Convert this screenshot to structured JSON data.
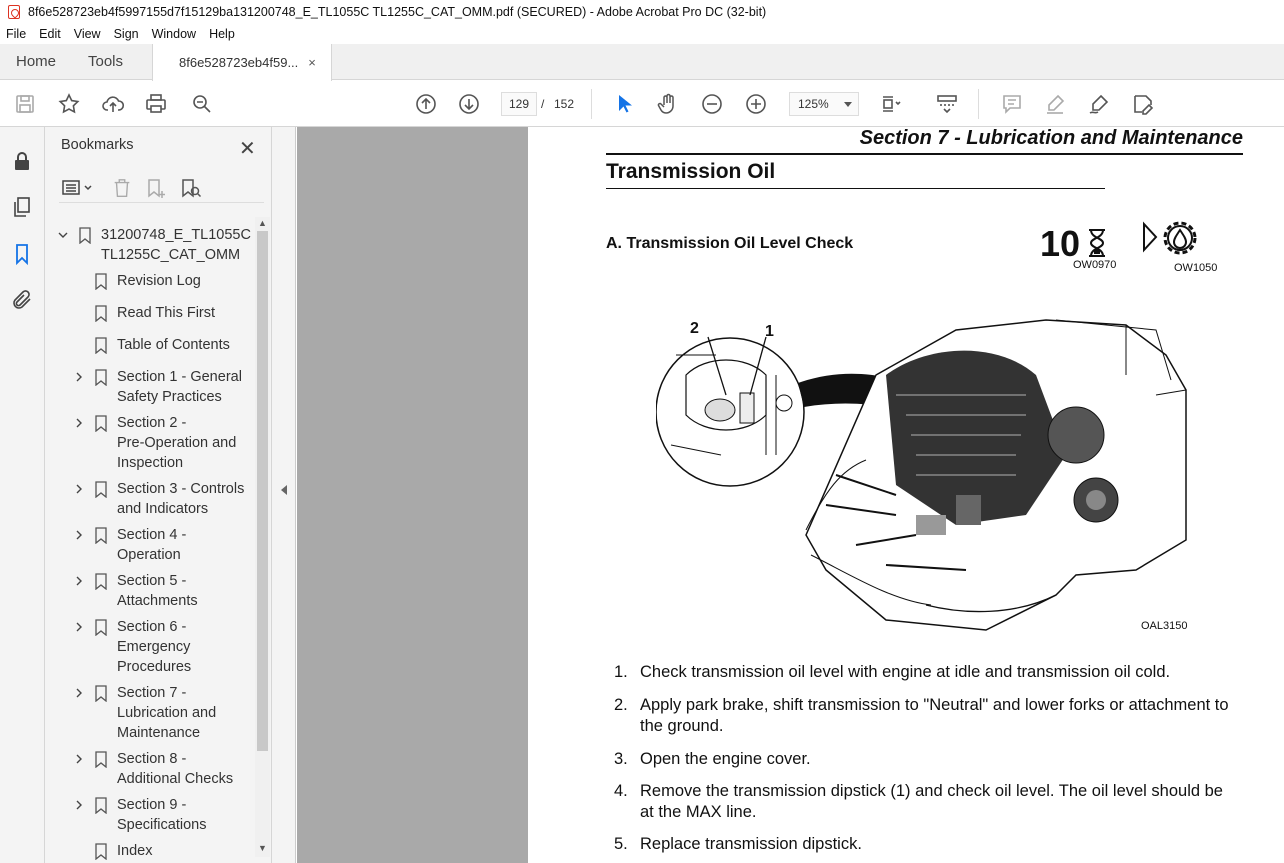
{
  "window": {
    "title": "8f6e528723eb4f5997155d7f15129ba131200748_E_TL1055C TL1255C_CAT_OMM.pdf (SECURED) - Adobe Acrobat Pro DC (32-bit)"
  },
  "menu": [
    "File",
    "Edit",
    "View",
    "Sign",
    "Window",
    "Help"
  ],
  "tabs": {
    "home": "Home",
    "tools": "Tools",
    "document": "8f6e528723eb4f59...",
    "close": "×"
  },
  "toolbar": {
    "icons": [
      "save-icon",
      "star-icon",
      "upload-icon",
      "print-icon",
      "search-zoom-icon",
      "page-up-icon",
      "page-down-icon",
      "select-arrow-icon",
      "hand-icon",
      "zoom-out-icon",
      "zoom-in-icon",
      "fit-page-icon",
      "scroll-mode-icon",
      "comment-icon",
      "highlight-icon",
      "sign-icon",
      "edit-icon"
    ],
    "current_page": "129",
    "separator": "/",
    "total_pages": "152",
    "zoom": "125%",
    "accent_color": "#1473e6"
  },
  "bookmarks": {
    "header": "Bookmarks",
    "close": "✕",
    "root": "31200748_E_TL1055C\nTL1255C_CAT_OMM",
    "items": [
      {
        "label": "Revision Log",
        "expandable": false
      },
      {
        "label": "Read This First",
        "expandable": false
      },
      {
        "label": "Table of Contents",
        "expandable": false
      },
      {
        "label": "Section 1 - General\nSafety Practices",
        "expandable": true
      },
      {
        "label": "Section 2 -\nPre-Operation and\nInspection",
        "expandable": true
      },
      {
        "label": "Section 3 - Controls\nand Indicators",
        "expandable": true
      },
      {
        "label": "Section 4 -\nOperation",
        "expandable": true
      },
      {
        "label": "Section 5 -\nAttachments",
        "expandable": true
      },
      {
        "label": "Section 6 -\nEmergency\nProcedures",
        "expandable": true
      },
      {
        "label": "Section 7 -\nLubrication and\nMaintenance",
        "expandable": true
      },
      {
        "label": "Section 8 -\nAdditional Checks",
        "expandable": true
      },
      {
        "label": "Section 9 -\nSpecifications",
        "expandable": true
      },
      {
        "label": "Index",
        "expandable": false
      }
    ]
  },
  "page": {
    "section_header": "Section 7 - Lubrication and Maintenance",
    "title": "Transmission Oil",
    "subheading": "A. Transmission Oil Level Check",
    "interval": "10",
    "code_interval": "OW0970",
    "code_oil": "OW1050",
    "figure_label": "OAL3150",
    "callouts": [
      "2",
      "1"
    ],
    "steps": [
      {
        "num": "1.",
        "text": "Check transmission oil level with engine at idle and transmission oil cold."
      },
      {
        "num": "2.",
        "text": "Apply park brake, shift transmission to \"Neutral\" and lower forks or attachment to the ground."
      },
      {
        "num": "3.",
        "text": "Open the engine cover."
      },
      {
        "num": "4.",
        "text": "Remove the transmission dipstick (1) and check oil level. The oil level should be at the MAX line."
      },
      {
        "num": "5.",
        "text": "Replace transmission dipstick."
      }
    ]
  }
}
